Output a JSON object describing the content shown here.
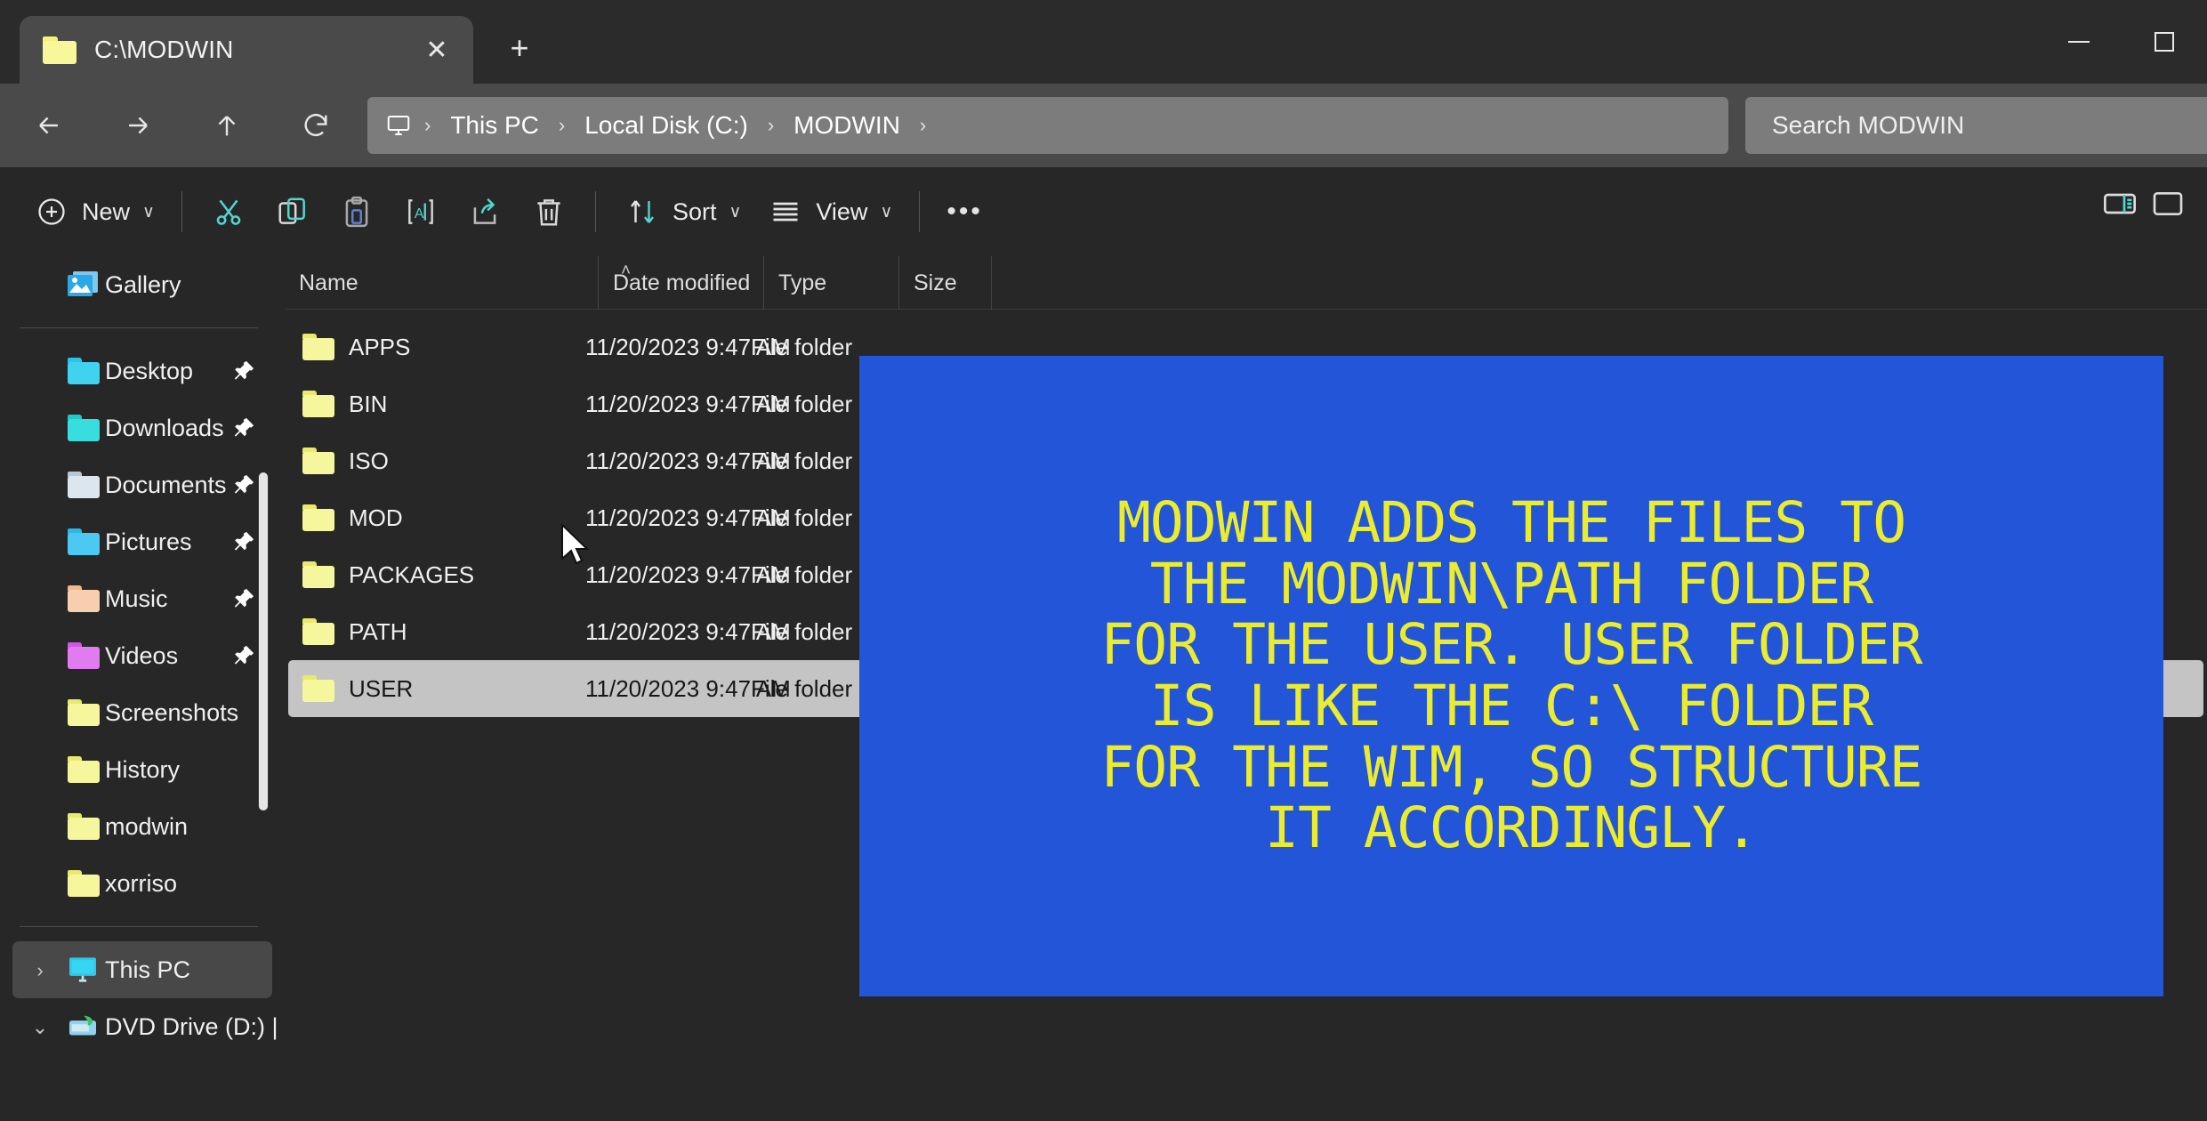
{
  "window": {
    "tab_title": "C:\\MODWIN",
    "close_glyph": "✕",
    "newtab_glyph": "+",
    "minimize_label": "Minimize",
    "maximize_label": "Maximize"
  },
  "address_bar": {
    "back_label": "Back",
    "forward_label": "Forward",
    "up_label": "Up",
    "refresh_label": "Refresh",
    "breadcrumbs": [
      "This PC",
      "Local Disk (C:)",
      "MODWIN"
    ],
    "separator": "›",
    "search_placeholder": "Search MODWIN"
  },
  "toolbar": {
    "new_label": "New",
    "cut_label": "Cut",
    "copy_label": "Copy",
    "paste_label": "Paste",
    "rename_label": "Rename",
    "share_label": "Share",
    "delete_label": "Delete",
    "sort_label": "Sort",
    "view_label": "View",
    "more_label": "•••",
    "details_pane_label": "Details pane",
    "chevron": "∨"
  },
  "sidebar": {
    "items": [
      {
        "label": "Gallery",
        "icon": "gallery-icon",
        "color": "blue",
        "pinned": false,
        "expander": ""
      },
      {
        "label": "Desktop",
        "icon": "folder-icon",
        "color": "cyan",
        "pinned": true,
        "expander": ""
      },
      {
        "label": "Downloads",
        "icon": "folder-icon",
        "color": "teal",
        "pinned": true,
        "expander": ""
      },
      {
        "label": "Documents",
        "icon": "folder-icon",
        "color": "white",
        "pinned": true,
        "expander": ""
      },
      {
        "label": "Pictures",
        "icon": "folder-icon",
        "color": "blue",
        "pinned": true,
        "expander": ""
      },
      {
        "label": "Music",
        "icon": "folder-icon",
        "color": "peach",
        "pinned": true,
        "expander": ""
      },
      {
        "label": "Videos",
        "icon": "folder-icon",
        "color": "purple",
        "pinned": true,
        "expander": ""
      },
      {
        "label": "Screenshots",
        "icon": "folder-icon",
        "color": "yellow",
        "pinned": false,
        "expander": ""
      },
      {
        "label": "History",
        "icon": "folder-icon",
        "color": "yellow",
        "pinned": false,
        "expander": ""
      },
      {
        "label": "modwin",
        "icon": "folder-icon",
        "color": "yellow",
        "pinned": false,
        "expander": ""
      },
      {
        "label": "xorriso",
        "icon": "folder-icon",
        "color": "yellow",
        "pinned": false,
        "expander": ""
      }
    ],
    "this_pc": {
      "label": "This PC",
      "icon": "monitor-icon",
      "expander": "›",
      "selected": true
    },
    "dvd_drive": {
      "label": "DVD Drive (D:) |",
      "icon": "dvd-icon",
      "expander": "⌄"
    }
  },
  "file_list": {
    "columns": [
      {
        "key": "name",
        "label": "Name"
      },
      {
        "key": "date",
        "label": "Date modified"
      },
      {
        "key": "type",
        "label": "Type"
      },
      {
        "key": "size",
        "label": "Size"
      }
    ],
    "sort_indicator": "˄",
    "rows": [
      {
        "name": "APPS",
        "date": "11/20/2023 9:47 AM",
        "type": "File folder",
        "size": "",
        "selected": false
      },
      {
        "name": "BIN",
        "date": "11/20/2023 9:47 AM",
        "type": "File folder",
        "size": "",
        "selected": false
      },
      {
        "name": "ISO",
        "date": "11/20/2023 9:47 AM",
        "type": "File folder",
        "size": "",
        "selected": false
      },
      {
        "name": "MOD",
        "date": "11/20/2023 9:47 AM",
        "type": "File folder",
        "size": "",
        "selected": false
      },
      {
        "name": "PACKAGES",
        "date": "11/20/2023 9:47 AM",
        "type": "File folder",
        "size": "",
        "selected": false
      },
      {
        "name": "PATH",
        "date": "11/20/2023 9:47 AM",
        "type": "File folder",
        "size": "",
        "selected": false
      },
      {
        "name": "USER",
        "date": "11/20/2023 9:47 AM",
        "type": "File folder",
        "size": "",
        "selected": true
      }
    ]
  },
  "overlay": {
    "background_color": "#2255d8",
    "text_color": "#ecec2e",
    "lines": [
      "MODWIN ADDS THE FILES TO",
      "THE MODWIN\\PATH FOLDER",
      "FOR THE USER. USER FOLDER",
      "IS LIKE THE C:\\ FOLDER",
      "FOR THE WIM, SO STRUCTURE",
      "IT ACCORDINGLY."
    ]
  }
}
